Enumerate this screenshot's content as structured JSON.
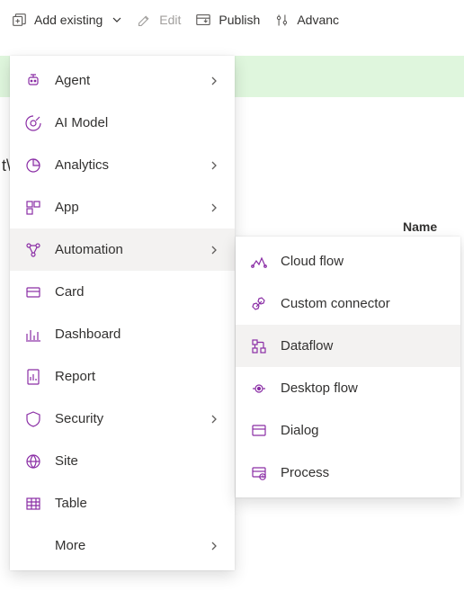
{
  "toolbar": {
    "add_existing": "Add existing",
    "edit": "Edit",
    "publish": "Publish",
    "advanced": "Advanc"
  },
  "column": {
    "name": "Name"
  },
  "menu": {
    "items": [
      {
        "label": "Agent",
        "has_sub": true
      },
      {
        "label": "AI Model",
        "has_sub": false
      },
      {
        "label": "Analytics",
        "has_sub": true
      },
      {
        "label": "App",
        "has_sub": true
      },
      {
        "label": "Automation",
        "has_sub": true,
        "hovered": true
      },
      {
        "label": "Card",
        "has_sub": false
      },
      {
        "label": "Dashboard",
        "has_sub": false
      },
      {
        "label": "Report",
        "has_sub": false
      },
      {
        "label": "Security",
        "has_sub": true
      },
      {
        "label": "Site",
        "has_sub": false
      },
      {
        "label": "Table",
        "has_sub": false
      },
      {
        "label": "More",
        "has_sub": true,
        "no_icon": true
      }
    ]
  },
  "submenu": {
    "items": [
      {
        "label": "Cloud flow"
      },
      {
        "label": "Custom connector"
      },
      {
        "label": "Dataflow",
        "hovered": true
      },
      {
        "label": "Desktop flow"
      },
      {
        "label": "Dialog"
      },
      {
        "label": "Process"
      }
    ]
  }
}
